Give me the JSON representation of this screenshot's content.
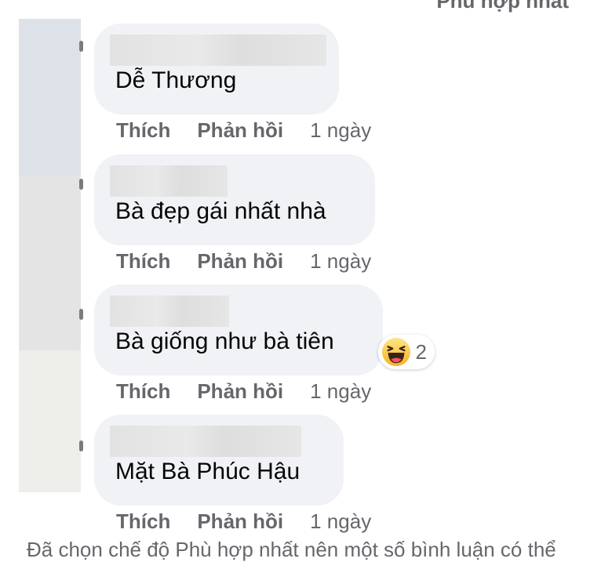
{
  "header": {
    "sort_label": "Phù hợp nhất"
  },
  "actions": {
    "like_label": "Thích",
    "reply_label": "Phản hồi"
  },
  "comments": [
    {
      "text": "Dễ Thương",
      "time": "1 ngày"
    },
    {
      "text": "Bà đẹp gái nhất nhà",
      "time": "1 ngày"
    },
    {
      "text": "Bà giống như bà tiên",
      "time": "1 ngày",
      "reaction": {
        "icon": "haha-emoji-icon",
        "count": "2"
      }
    },
    {
      "text": "Mặt Bà Phúc Hậu",
      "time": "1 ngày"
    }
  ],
  "footer": {
    "note": "Đã chọn chế độ Phù hợp nhất nên một số bình luận có thể"
  },
  "colors": {
    "bubble": "#f0f2f5",
    "secondary_text": "#65676b",
    "haha_yellow": "#f7b125"
  }
}
